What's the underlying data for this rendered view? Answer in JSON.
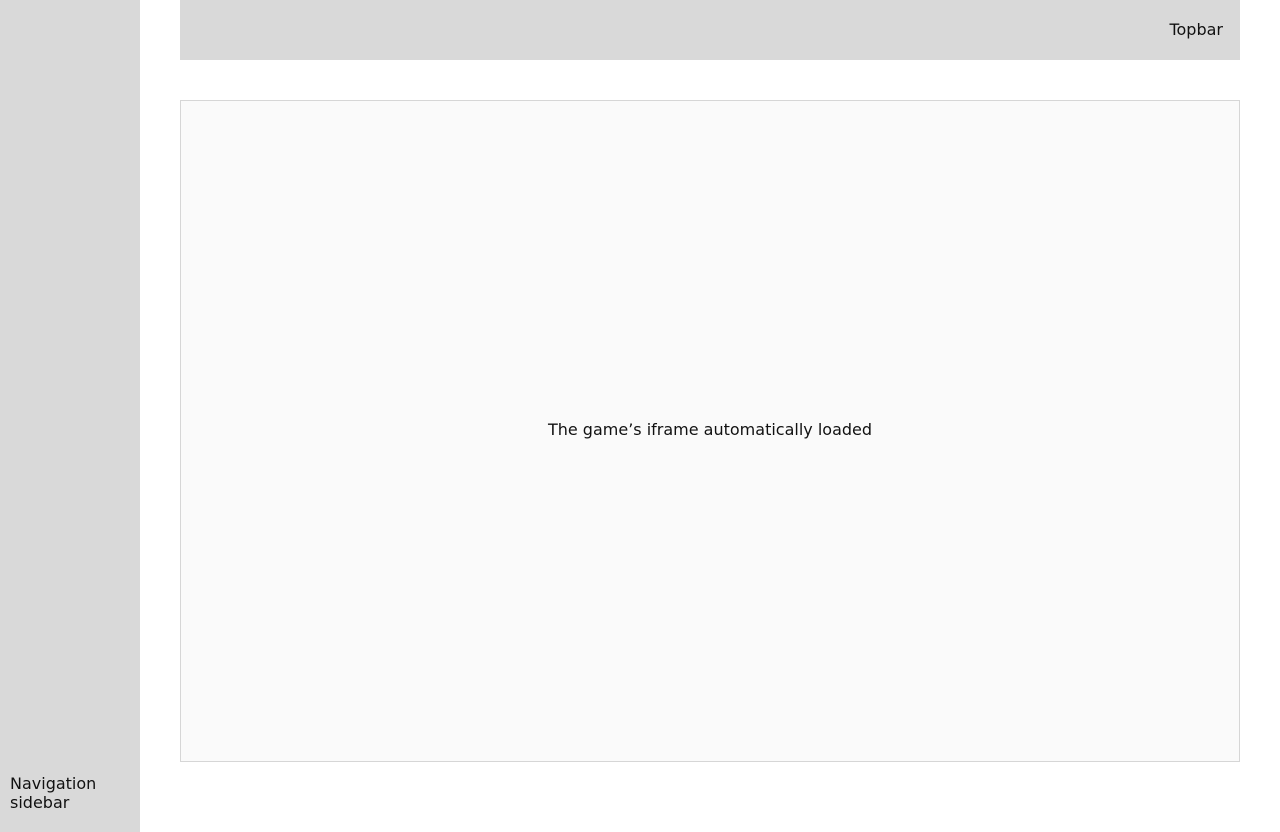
{
  "sidebar": {
    "label": "Navigation sidebar"
  },
  "topbar": {
    "label": "Topbar"
  },
  "game": {
    "iframe_label": "The game’s iframe automatically loaded"
  },
  "colors": {
    "sidebar_bg": "#d9d9d9",
    "topbar_bg": "#d9d9d9",
    "frame_bg": "#fafafa",
    "frame_border": "#d6d6d6",
    "text": "#111111"
  }
}
